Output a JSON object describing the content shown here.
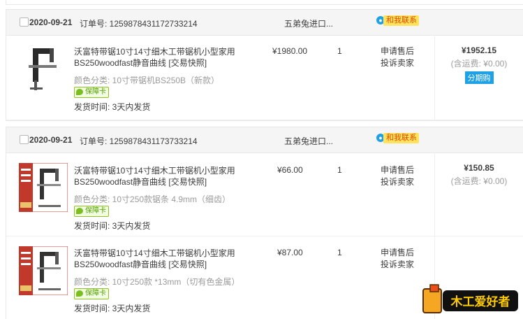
{
  "orders": [
    {
      "date": "2020-09-21",
      "order_no_label": "订单号: 1259878431172733214",
      "shop": "五弟兔进口...",
      "contact": "和我联系",
      "total": "¥1952.15",
      "shipping_fee": "(含运费: ¥0.00)",
      "installment": "分期购",
      "items": [
        {
          "title": "沃富特带锯10寸14寸细木工带锯机小型家用BS250woodfast静音曲线 [交易快照]",
          "sku": "颜色分类: 10寸带锯机BS250B（新款）",
          "badge": "保障卡",
          "ship": "发货时间: 3天内发货",
          "price": "¥1980.00",
          "qty": "1",
          "svc1": "申请售后",
          "svc2": "投诉卖家"
        }
      ]
    },
    {
      "date": "2020-09-21",
      "order_no_label": "订单号: 1259878431173733214",
      "shop": "五弟兔进口...",
      "contact": "和我联系",
      "total": "¥150.85",
      "shipping_fee": "(含运费: ¥0.00)",
      "items": [
        {
          "title": "沃富特带锯10寸14寸细木工带锯机小型家用BS250woodfast静音曲线 [交易快照]",
          "sku": "颜色分类: 10寸250款锯条 4.9mm（细齿）",
          "badge": "保障卡",
          "ship": "发货时间: 3天内发货",
          "price": "¥66.00",
          "qty": "1",
          "svc1": "申请售后",
          "svc2": "投诉卖家"
        },
        {
          "title": "沃富特带锯10寸14寸细木工带锯机小型家用BS250woodfast静音曲线 [交易快照]",
          "sku": "颜色分类: 10寸250款 *13mm（切有色金属）",
          "badge": "保障卡",
          "ship": "发货时间: 3天内发货",
          "price": "¥87.00",
          "qty": "1",
          "svc1": "申请售后",
          "svc2": "投诉卖家"
        }
      ]
    }
  ],
  "watermark": "木工爱好者",
  "colors": {
    "accent_blue": "#20a0e5",
    "contact_yellow": "#ffe25e",
    "badge_green": "#8fc31f"
  }
}
